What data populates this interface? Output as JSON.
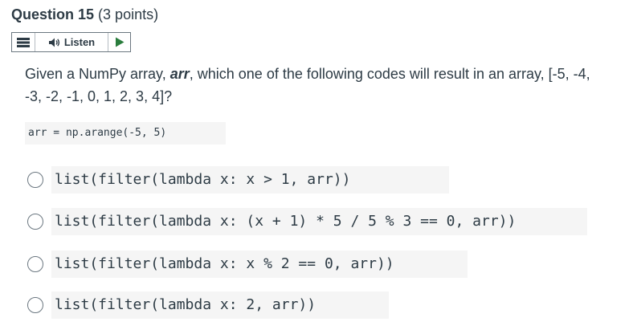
{
  "question": {
    "number_label": "Question 15",
    "points_label": "(3 points)"
  },
  "listen_bar": {
    "menu_icon": "menu-icon",
    "speaker_icon": "speaker-icon",
    "listen_label": "Listen",
    "play_icon": "play-icon",
    "accent_color": "#2a7d3d"
  },
  "prompt": {
    "part1": "Given a NumPy array, ",
    "var": "arr",
    "part2": ", which one of the following codes will result in an array, [-5, -4, -3, -2, -1, 0, 1, 2, 3, 4]?"
  },
  "code": "arr = np.arange(-5, 5)",
  "answers": [
    "list(filter(lambda x: x > 1, arr))",
    "list(filter(lambda x: (x + 1) * 5 / 5 % 3 == 0, arr))",
    "list(filter(lambda x: x % 2 == 0, arr))",
    "list(filter(lambda x: 2, arr))"
  ]
}
